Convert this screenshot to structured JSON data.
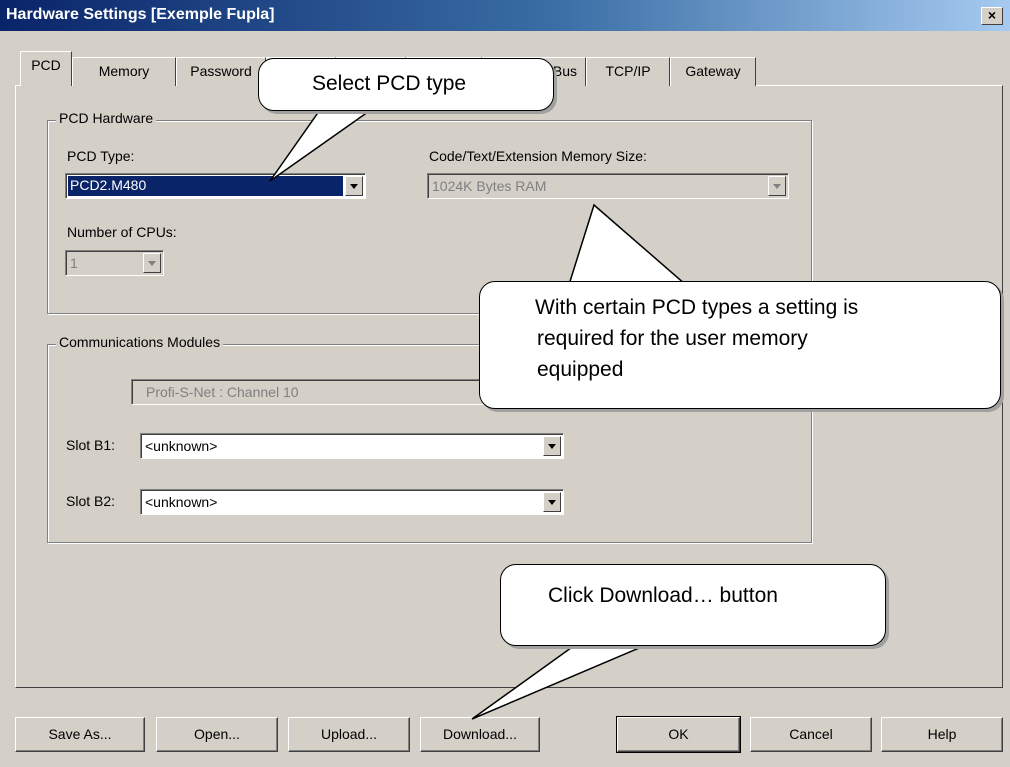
{
  "window": {
    "title": "Hardware Settings [Exemple Fupla]",
    "close_label": "×"
  },
  "tabs": [
    {
      "label": "PCD"
    },
    {
      "label": "Memory"
    },
    {
      "label": "Password"
    },
    {
      "label": ""
    },
    {
      "label": ""
    },
    {
      "label": ""
    },
    {
      "label": "Bus"
    },
    {
      "label": "TCP/IP"
    },
    {
      "label": "Gateway"
    }
  ],
  "pcd_hardware": {
    "group_label": "PCD Hardware",
    "pcd_type_label": "PCD Type:",
    "pcd_type_value": "PCD2.M480",
    "memory_label": "Code/Text/Extension Memory Size:",
    "memory_value": "1024K Bytes RAM",
    "cpus_label": "Number of CPUs:",
    "cpus_value": "1"
  },
  "comm_modules": {
    "group_label": "Communications Modules",
    "channel_value": "Profi-S-Net : Channel 10",
    "slot_b1_label": "Slot B1:",
    "slot_b1_value": "<unknown>",
    "slot_b2_label": "Slot B2:",
    "slot_b2_value": "<unknown>"
  },
  "buttons": {
    "save_as": "Save As...",
    "open": "Open...",
    "upload": "Upload...",
    "download": "Download...",
    "ok": "OK",
    "cancel": "Cancel",
    "help": "Help"
  },
  "callouts": {
    "select_pcd": "Select PCD type",
    "memory_note_line1": "With certain PCD types a setting is",
    "memory_note_line2": "required for the user memory",
    "memory_note_line3": "equipped",
    "download_note": "Click Download… button"
  }
}
